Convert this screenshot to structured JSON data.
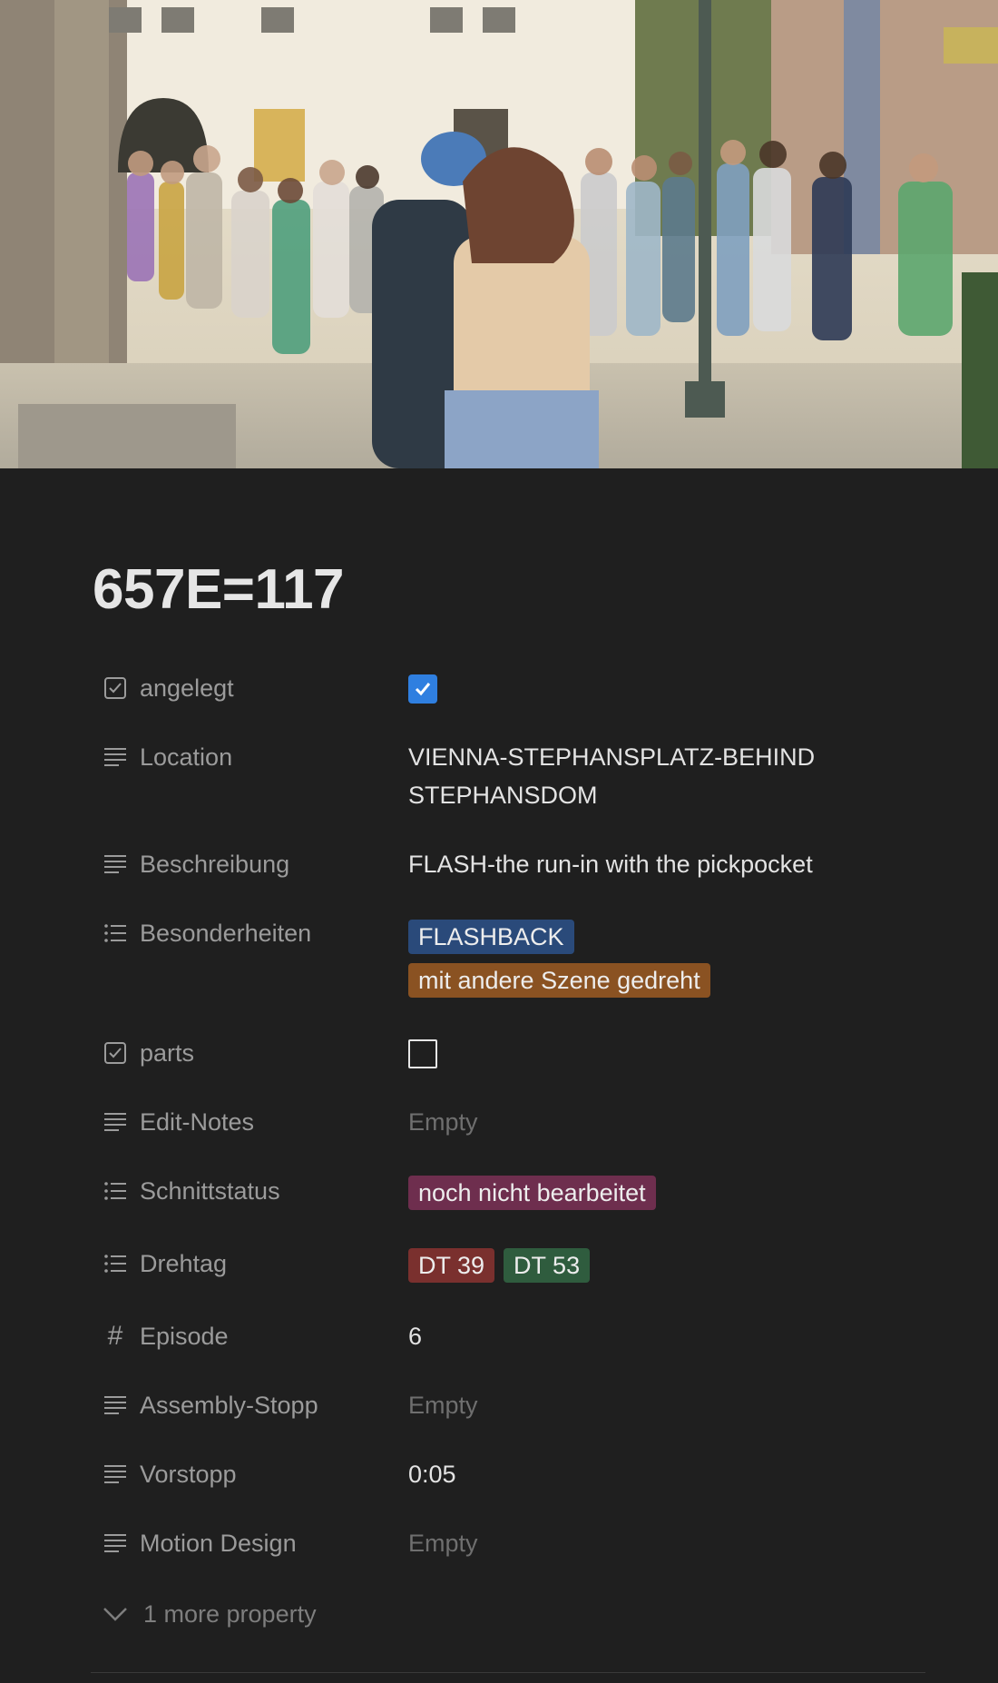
{
  "page": {
    "title": "657E=117"
  },
  "properties": [
    {
      "name": "angelegt",
      "icon": "checkbox-icon",
      "type": "checkbox",
      "checked": true
    },
    {
      "name": "Location",
      "icon": "text-lines-icon",
      "type": "text",
      "value": "VIENNA-STEPHANSPLATZ-BEHIND STEPHANSDOM"
    },
    {
      "name": "Beschreibung",
      "icon": "text-lines-icon",
      "type": "text",
      "value": "FLASH-the run-in with the pickpocket"
    },
    {
      "name": "Besonderheiten",
      "icon": "list-icon",
      "type": "multiselect",
      "tags": [
        {
          "label": "FLASHBACK",
          "color": "#2a4a7a"
        },
        {
          "label": "mit andere Szene gedreht",
          "color": "#8a5222"
        }
      ]
    },
    {
      "name": "parts",
      "icon": "checkbox-icon",
      "type": "checkbox",
      "checked": false
    },
    {
      "name": "Edit-Notes",
      "icon": "text-lines-icon",
      "type": "text",
      "value": "Empty",
      "empty": true
    },
    {
      "name": "Schnittstatus",
      "icon": "list-icon",
      "type": "multiselect",
      "tags": [
        {
          "label": "noch nicht bearbeitet",
          "color": "#6e2e4e"
        }
      ]
    },
    {
      "name": "Drehtag",
      "icon": "list-icon",
      "type": "multiselect",
      "tags": [
        {
          "label": "DT 39",
          "color": "#7a302e"
        },
        {
          "label": "DT 53",
          "color": "#2f5c3e"
        }
      ]
    },
    {
      "name": "Episode",
      "icon": "hash-icon",
      "type": "number",
      "value": "6"
    },
    {
      "name": "Assembly-Stopp",
      "icon": "text-lines-icon",
      "type": "text",
      "value": "Empty",
      "empty": true
    },
    {
      "name": "Vorstopp",
      "icon": "text-lines-icon",
      "type": "text",
      "value": "0:05"
    },
    {
      "name": "Motion Design",
      "icon": "text-lines-icon",
      "type": "text",
      "value": "Empty",
      "empty": true
    }
  ],
  "more": {
    "label": "1 more property",
    "icon": "chevron-down-icon"
  },
  "colors": {
    "background": "#1f1f1f",
    "checkbox_accent": "#2f7fe0"
  }
}
